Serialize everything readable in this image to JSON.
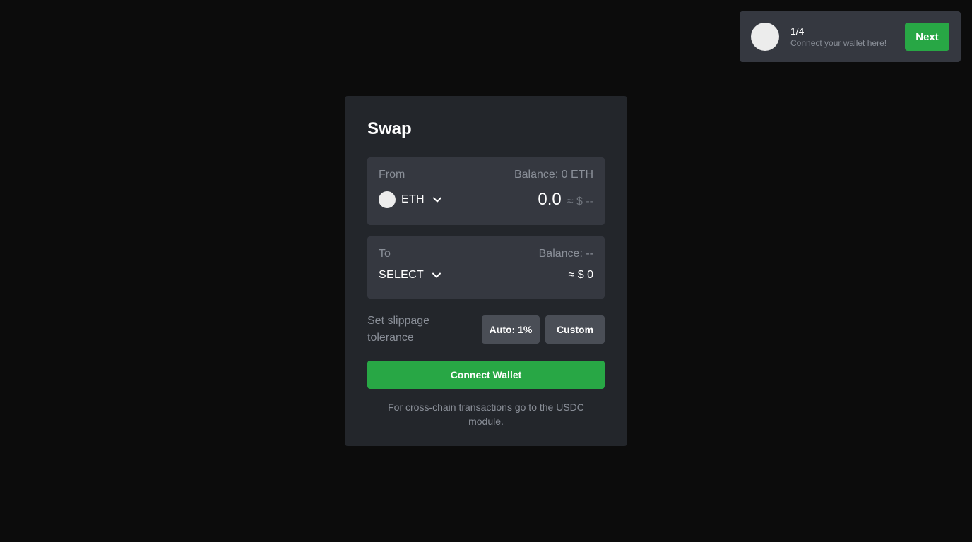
{
  "tour": {
    "step": "1/4",
    "description": "Connect your wallet here!",
    "next_label": "Next"
  },
  "swap": {
    "title": "Swap",
    "from": {
      "label": "From",
      "balance": "Balance: 0 ETH",
      "token": "ETH",
      "amount": "0.0",
      "usd_value": "≈ $ --"
    },
    "to": {
      "label": "To",
      "balance": "Balance: --",
      "token": "SELECT",
      "usd_value": "≈ $ 0"
    },
    "slippage": {
      "label": "Set slippage tolerance",
      "auto_label": "Auto: 1%",
      "custom_label": "Custom"
    },
    "connect_label": "Connect Wallet",
    "footnote": "For cross-chain transactions go to the USDC module."
  },
  "icons": {
    "tour_avatar": "avatar-icon",
    "eth_token": "eth-token-icon",
    "chevron": "chevron-down-icon"
  },
  "colors": {
    "background": "#0c0c0c",
    "card": "#23262b",
    "panel": "#353840",
    "accent_green": "#28a745",
    "muted_text": "#8a8f98"
  }
}
